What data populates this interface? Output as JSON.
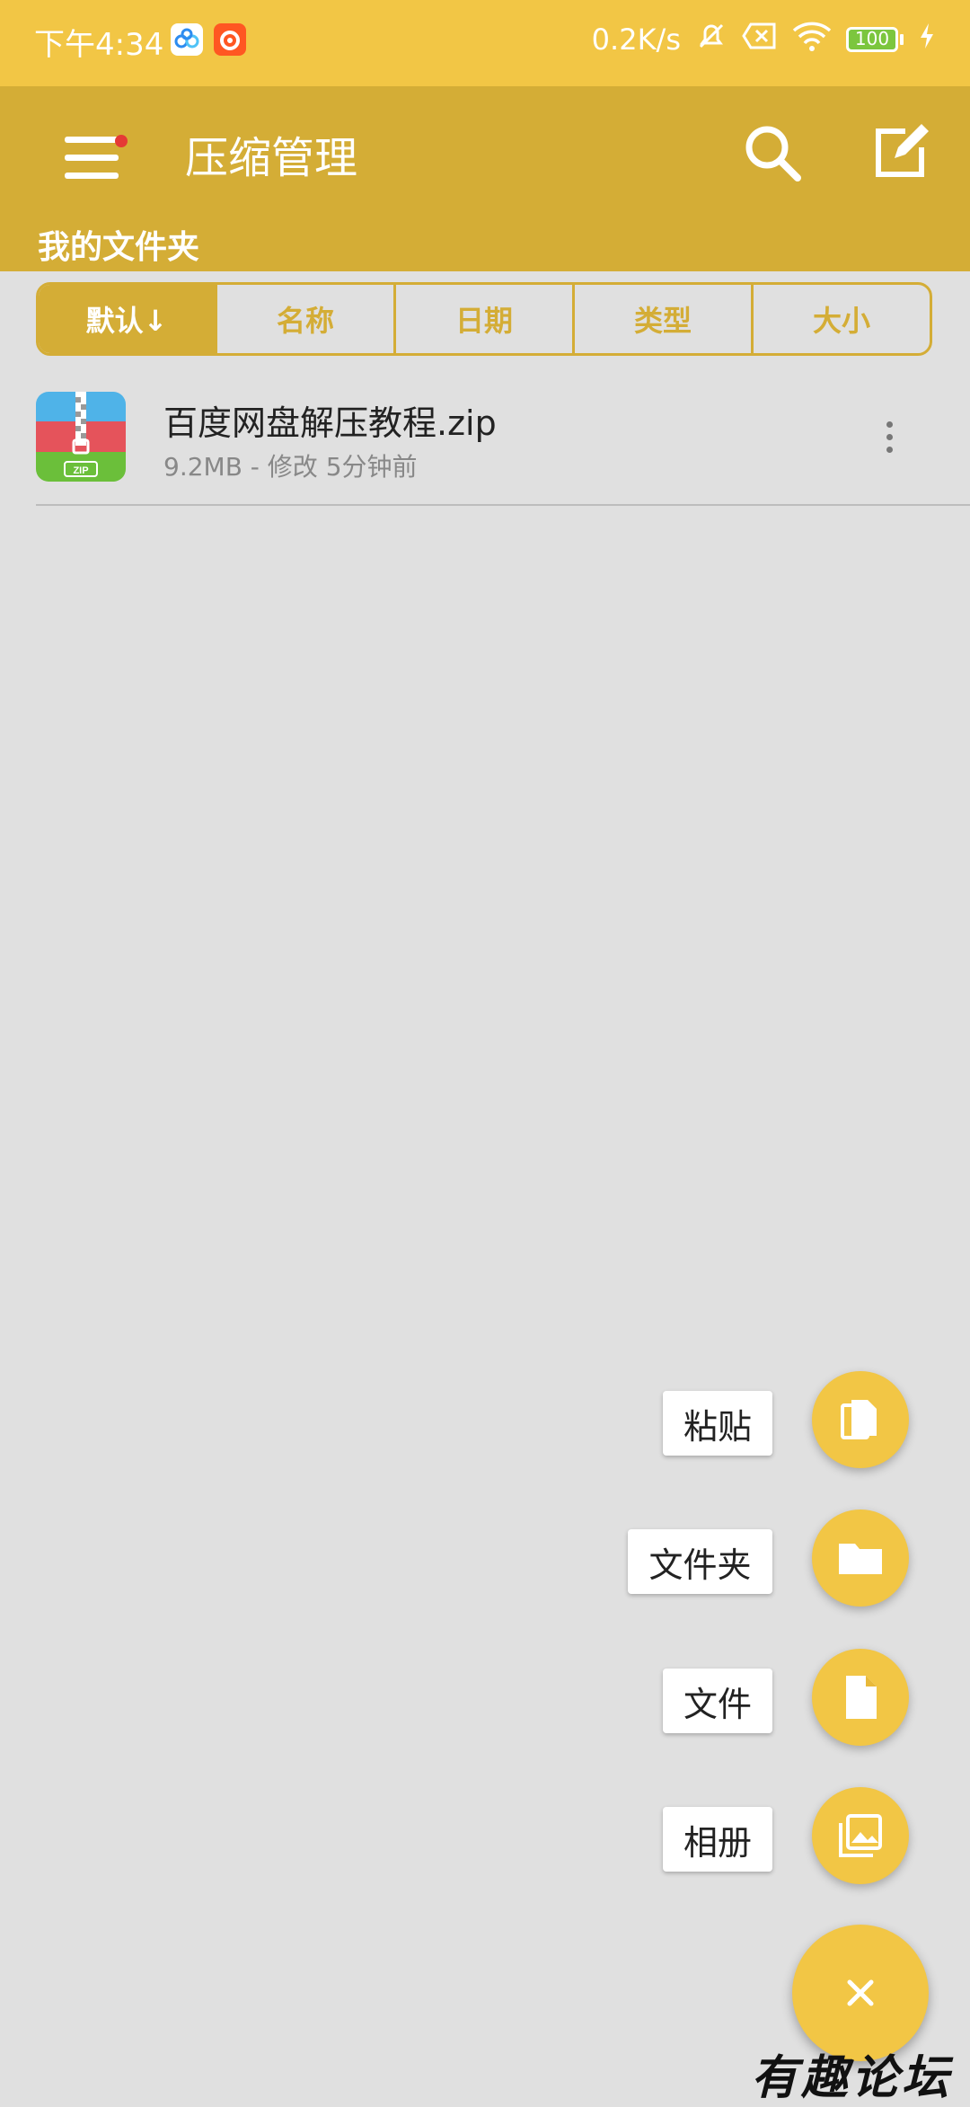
{
  "status_bar": {
    "time": "下午4:34",
    "network_speed": "0.2K/s",
    "battery": "100",
    "icons": [
      "baidu-netdisk-icon",
      "app-notification-icon",
      "mute-icon",
      "sim-off-icon",
      "wifi-icon",
      "battery-icon",
      "charging-icon"
    ]
  },
  "app_bar": {
    "title": "压缩管理",
    "menu_icon": "hamburger-menu-icon",
    "search_icon": "search-icon",
    "edit_icon": "edit-icon",
    "notification_dot_color": "#e53935"
  },
  "folder_label": "我的文件夹",
  "sort_tabs": [
    "默认↓",
    "名称",
    "日期",
    "类型",
    "大小"
  ],
  "selected_sort": "默认↓",
  "files": [
    {
      "name": "百度网盘解压教程.zip",
      "meta": "9.2MB - 修改 5分钟前",
      "icon": "zip-file-icon",
      "icon_label": "ZIP"
    }
  ],
  "fab_menu": [
    {
      "label": "粘贴",
      "icon": "paste-icon"
    },
    {
      "label": "文件夹",
      "icon": "folder-icon"
    },
    {
      "label": "文件",
      "icon": "file-icon"
    },
    {
      "label": "相册",
      "icon": "album-icon"
    }
  ],
  "main_fab_icon": "close-icon",
  "watermark": "有趣论坛",
  "colors": {
    "status_bar": "#f2c645",
    "app_bar": "#d4ad36",
    "accent": "#f2c645",
    "background": "#e0e0e0"
  }
}
